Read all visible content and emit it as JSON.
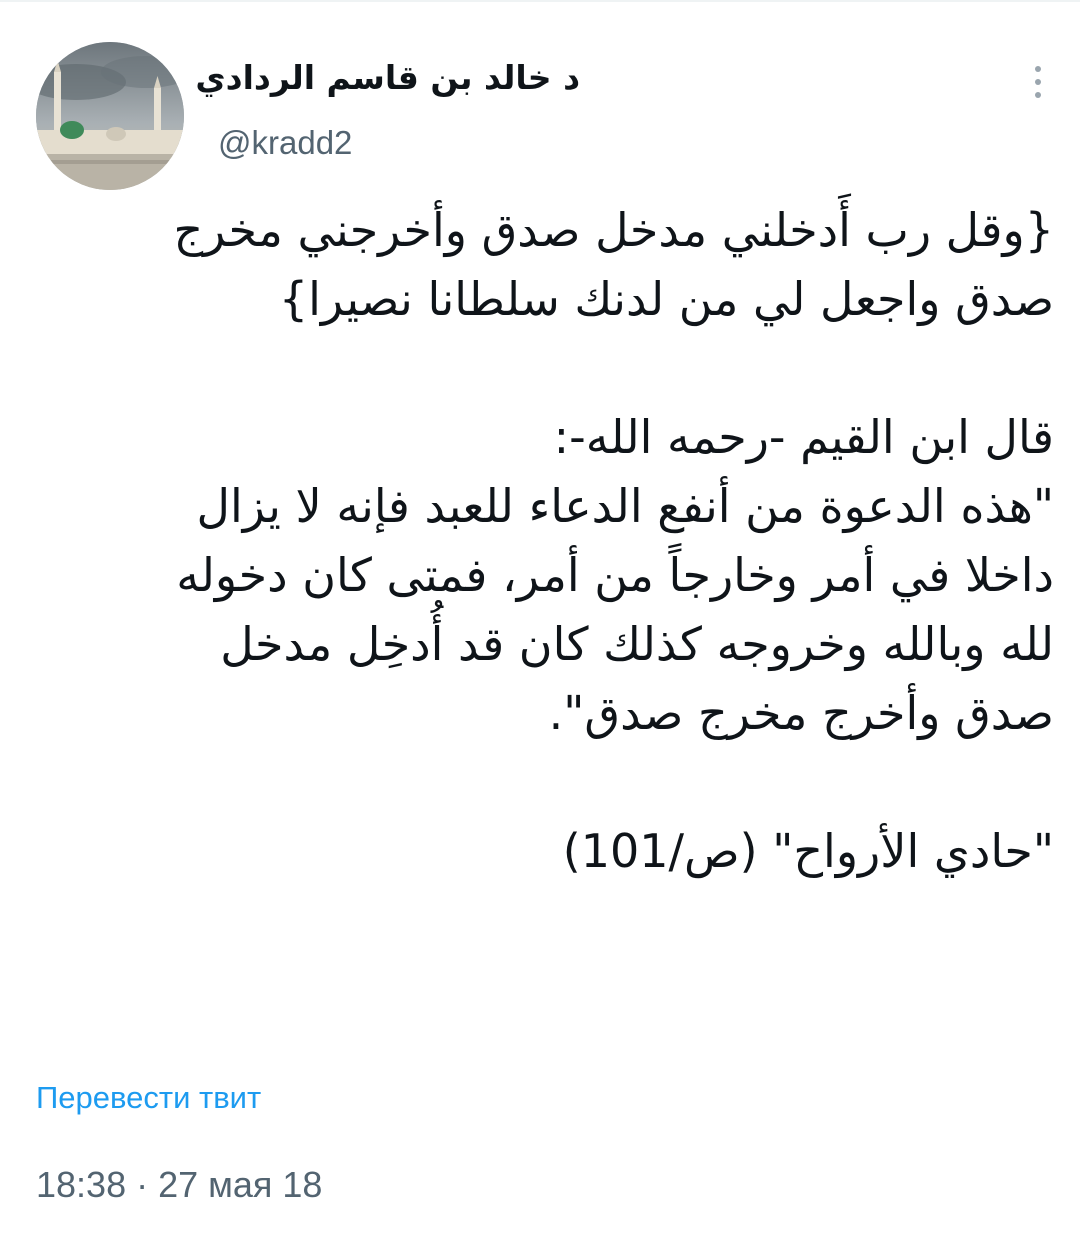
{
  "tweet": {
    "display_name": "د خالد بن قاسم الردادي",
    "handle": "@kradd2",
    "body_lines": [
      "{وقل رب أَدخلني مدخل صدق وأخرجني مخرج",
      "صدق واجعل لي من لدنك سلطانا نصيرا}",
      "",
      "قال ابن القيم -رحمه الله-:",
      "\"هذه الدعوة من أنفع الدعاء للعبد فإنه لا يزال",
      "داخلا في أمر وخارجاً من أمر، فمتى كان دخوله",
      "لله وبالله وخروجه كذلك كان قد أُدخِل مدخل",
      "صدق وأخرج مخرج صدق\".",
      "",
      "\"حادي الأرواح\" (ص/101)"
    ],
    "translate_label": "Перевести твит",
    "timestamp": "18:38 · 27 мая 18"
  },
  "icons": {
    "more": "more-vertical-icon",
    "avatar": "avatar-mosque-photo"
  },
  "colors": {
    "link": "#1d9bf0",
    "secondary_text": "#536471",
    "primary_text": "#0f1419"
  }
}
